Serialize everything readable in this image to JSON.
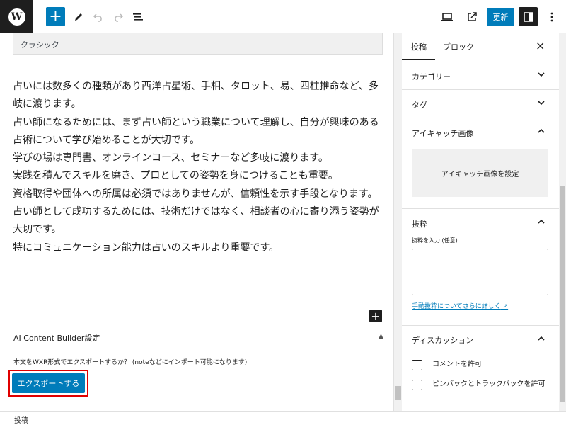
{
  "toolbar": {
    "logo_letter": "W",
    "add_label": "+",
    "update_label": "更新"
  },
  "editor": {
    "classic_block_label": "クラシック",
    "paragraphs": [
      "占いには数多くの種類があり西洋占星術、手相、タロット、易、四柱推命など、多岐に渡ります。",
      "占い師になるためには、まず占い師という職業について理解し、自分が興味のある占術について学び始めることが大切です。",
      "学びの場は専門書、オンラインコース、セミナーなど多岐に渡ります。",
      "実践を積んでスキルを磨き、プロとしての姿勢を身につけることも重要。",
      "資格取得や団体への所属は必須ではありませんが、信頼性を示す手段となります。",
      "占い師として成功するためには、技術だけではなく、相談者の心に寄り添う姿勢が大切です。",
      "特にコミュニケーション能力は占いのスキルより重要です。"
    ],
    "inserter_label": "+"
  },
  "meta_box": {
    "title": "AI Content Builder設定",
    "caret": "▲",
    "description": "本文をWXR形式でエクスポートするか？ (noteなどにインポート可能になります)",
    "export_button": "エクスポートする"
  },
  "sidebar": {
    "tabs": [
      "投稿",
      "ブロック"
    ],
    "close": "×",
    "panels": {
      "category": "カテゴリー",
      "tags": "タグ",
      "featured_image": "アイキャッチ画像",
      "featured_image_button": "アイキャッチ画像を設定",
      "excerpt": "抜粋",
      "excerpt_label": "抜粋を入力 (任意)",
      "excerpt_link": "手動抜粋についてさらに詳しく",
      "discussion": "ディスカッション",
      "allow_comments": "コメントを許可",
      "allow_pingbacks": "ピンバックとトラックバックを許可"
    }
  },
  "footer": {
    "breadcrumb": "投稿"
  },
  "colors": {
    "accent": "#007cba",
    "dark": "#1e1e1e",
    "highlight": "#e00000"
  }
}
